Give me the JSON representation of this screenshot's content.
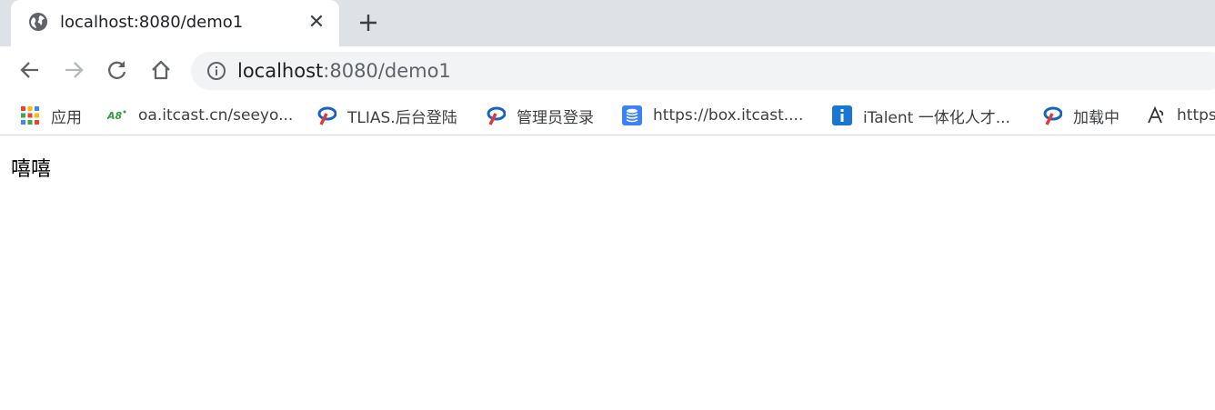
{
  "tab": {
    "title": "localhost:8080/demo1",
    "favicon": "globe-icon"
  },
  "toolbar": {
    "url_host": "localhost",
    "url_rest": ":8080/demo1"
  },
  "bookmarks": [
    {
      "label": "应用",
      "icon": "apps-grid-icon"
    },
    {
      "label": "oa.itcast.cn/seeyo...",
      "icon": "a8-logo-icon"
    },
    {
      "label": "TLIAS.后台登陆",
      "icon": "tlias-logo-icon"
    },
    {
      "label": "管理员登录",
      "icon": "tlias-logo-icon"
    },
    {
      "label": "https://box.itcast....",
      "icon": "database-icon"
    },
    {
      "label": "iTalent 一体化人才...",
      "icon": "info-badge-icon"
    },
    {
      "label": "加载中",
      "icon": "tlias-logo-icon"
    },
    {
      "label": "https",
      "icon": "link-logo-icon"
    }
  ],
  "page": {
    "text": "嘻嘻"
  },
  "colors": {
    "tabstrip": "#dee1e6",
    "omnibox": "#f1f3f4",
    "accent": "#4285f4"
  }
}
